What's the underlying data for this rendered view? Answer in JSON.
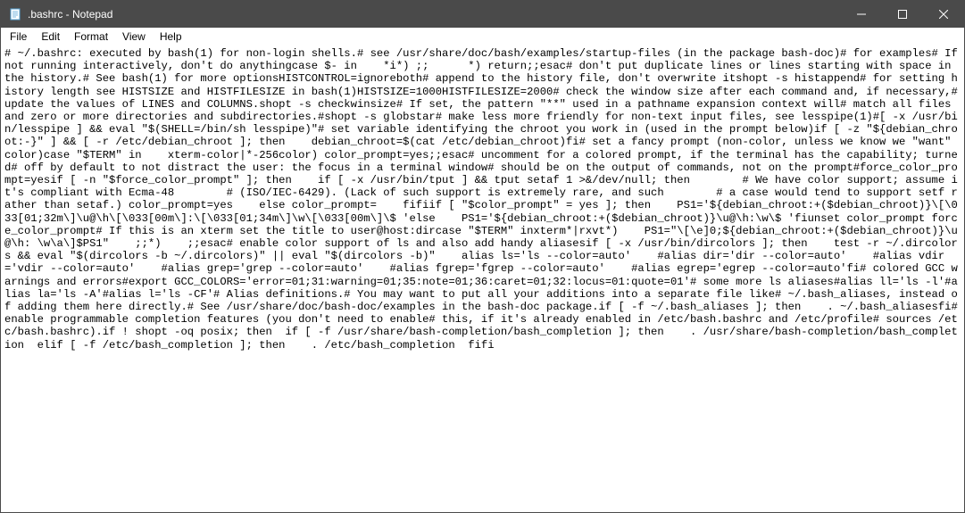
{
  "titlebar": {
    "title": ".bashrc - Notepad"
  },
  "menubar": {
    "file": "File",
    "edit": "Edit",
    "format": "Format",
    "view": "View",
    "help": "Help"
  },
  "content": {
    "text": "# ~/.bashrc: executed by bash(1) for non-login shells.# see /usr/share/doc/bash/examples/startup-files (in the package bash-doc)# for examples# If not running interactively, don't do anythingcase $- in    *i*) ;;      *) return;;esac# don't put duplicate lines or lines starting with space in the history.# See bash(1) for more optionsHISTCONTROL=ignoreboth# append to the history file, don't overwrite itshopt -s histappend# for setting history length see HISTSIZE and HISTFILESIZE in bash(1)HISTSIZE=1000HISTFILESIZE=2000# check the window size after each command and, if necessary,# update the values of LINES and COLUMNS.shopt -s checkwinsize# If set, the pattern \"**\" used in a pathname expansion context will# match all files and zero or more directories and subdirectories.#shopt -s globstar# make less more friendly for non-text input files, see lesspipe(1)#[ -x /usr/bin/lesspipe ] && eval \"$(SHELL=/bin/sh lesspipe)\"# set variable identifying the chroot you work in (used in the prompt below)if [ -z \"${debian_chroot:-}\" ] && [ -r /etc/debian_chroot ]; then    debian_chroot=$(cat /etc/debian_chroot)fi# set a fancy prompt (non-color, unless we know we \"want\" color)case \"$TERM\" in    xterm-color|*-256color) color_prompt=yes;;esac# uncomment for a colored prompt, if the terminal has the capability; turned# off by default to not distract the user: the focus in a terminal window# should be on the output of commands, not on the prompt#force_color_prompt=yesif [ -n \"$force_color_prompt\" ]; then    if [ -x /usr/bin/tput ] && tput setaf 1 >&/dev/null; then        # We have color support; assume it's compliant with Ecma-48        # (ISO/IEC-6429). (Lack of such support is extremely rare, and such        # a case would tend to support setf rather than setaf.) color_prompt=yes    else color_prompt=    fifiif [ \"$color_prompt\" = yes ]; then    PS1='${debian_chroot:+($debian_chroot)}\\[\\033[01;32m\\]\\u@\\h\\[\\033[00m\\]:\\[\\033[01;34m\\]\\w\\[\\033[00m\\]\\$ 'else    PS1='${debian_chroot:+($debian_chroot)}\\u@\\h:\\w\\$ 'fiunset color_prompt force_color_prompt# If this is an xterm set the title to user@host:dircase \"$TERM\" inxterm*|rxvt*)    PS1=\"\\[\\e]0;${debian_chroot:+($debian_chroot)}\\u@\\h: \\w\\a\\]$PS1\"    ;;*)    ;;esac# enable color support of ls and also add handy aliasesif [ -x /usr/bin/dircolors ]; then    test -r ~/.dircolors && eval \"$(dircolors -b ~/.dircolors)\" || eval \"$(dircolors -b)\"    alias ls='ls --color=auto'    #alias dir='dir --color=auto'    #alias vdir='vdir --color=auto'    #alias grep='grep --color=auto'    #alias fgrep='fgrep --color=auto'    #alias egrep='egrep --color=auto'fi# colored GCC warnings and errors#export GCC_COLORS='error=01;31:warning=01;35:note=01;36:caret=01;32:locus=01:quote=01'# some more ls aliases#alias ll='ls -l'#alias la='ls -A'#alias l='ls -CF'# Alias definitions.# You may want to put all your additions into a separate file like# ~/.bash_aliases, instead of adding them here directly.# See /usr/share/doc/bash-doc/examples in the bash-doc package.if [ -f ~/.bash_aliases ]; then    . ~/.bash_aliasesfi# enable programmable completion features (you don't need to enable# this, if it's already enabled in /etc/bash.bashrc and /etc/profile# sources /etc/bash.bashrc).if ! shopt -oq posix; then  if [ -f /usr/share/bash-completion/bash_completion ]; then    . /usr/share/bash-completion/bash_completion  elif [ -f /etc/bash_completion ]; then    . /etc/bash_completion  fifi"
  }
}
